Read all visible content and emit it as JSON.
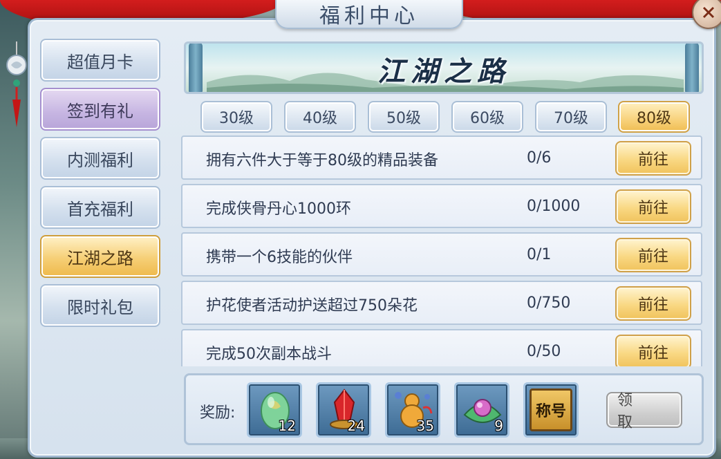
{
  "window": {
    "title": "福利中心"
  },
  "sidebar": {
    "items": [
      {
        "label": "超值月卡",
        "state": "normal"
      },
      {
        "label": "签到有礼",
        "state": "highlight"
      },
      {
        "label": "内测福利",
        "state": "normal"
      },
      {
        "label": "首充福利",
        "state": "normal"
      },
      {
        "label": "江湖之路",
        "state": "active"
      },
      {
        "label": "限时礼包",
        "state": "normal"
      }
    ]
  },
  "banner": {
    "title": "江湖之路"
  },
  "level_tabs": [
    {
      "label": "30级"
    },
    {
      "label": "40级"
    },
    {
      "label": "50级"
    },
    {
      "label": "60级"
    },
    {
      "label": "70级"
    },
    {
      "label": "80级",
      "active": true
    }
  ],
  "tasks": [
    {
      "description": "拥有六件大于等于80级的精品装备",
      "progress": "0/6",
      "button": "前往"
    },
    {
      "description": "完成侠骨丹心1000环",
      "progress": "0/1000",
      "button": "前往"
    },
    {
      "description": "携带一个6技能的伙伴",
      "progress": "0/1",
      "button": "前往"
    },
    {
      "description": "护花使者活动护送超过750朵花",
      "progress": "0/750",
      "button": "前往"
    },
    {
      "description": "完成50次副本战斗",
      "progress": "0/50",
      "button": "前往"
    }
  ],
  "rewards": {
    "label": "奖励:",
    "items": [
      {
        "icon": "green-gem-icon",
        "count": "12"
      },
      {
        "icon": "red-crystal-icon",
        "count": "24"
      },
      {
        "icon": "gourd-icon",
        "count": "35"
      },
      {
        "icon": "lotus-pearl-icon",
        "count": "9"
      },
      {
        "icon": "title-badge-icon",
        "text": "称号"
      }
    ],
    "claim_label": "领 取"
  },
  "colors": {
    "accent_gold": "#f6cf76",
    "panel_blue": "#d6e2ee",
    "curtain_red": "#c81515",
    "text_dark": "#2f3b52"
  }
}
